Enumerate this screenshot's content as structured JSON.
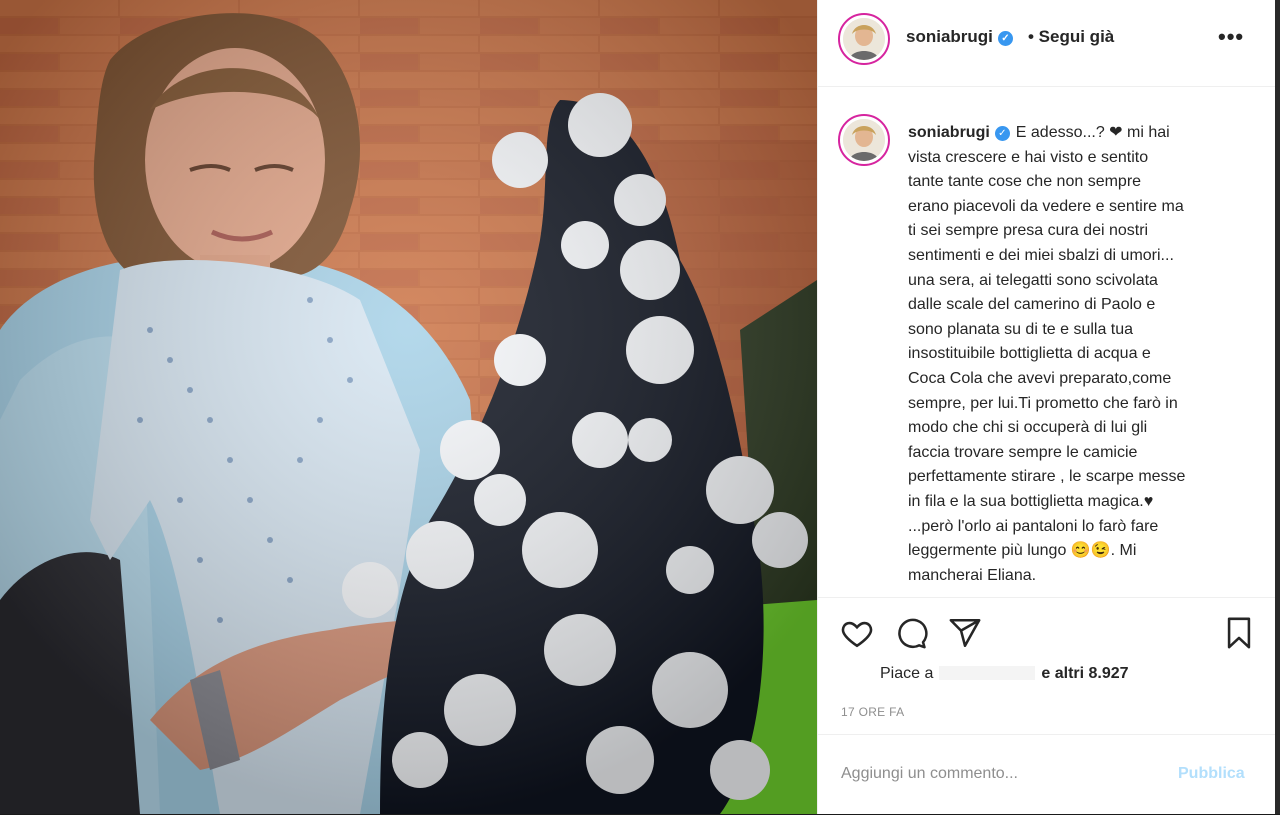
{
  "post": {
    "author": "soniabrugi",
    "follow_status": "• Segui già",
    "more_icon": "more-horizontal-icon",
    "caption_lines": [
      "E adesso...? ❤ mi hai",
      "vista crescere e hai visto e sentito",
      "tante tante cose che non sempre",
      "erano piacevoli da vedere e sentire ma",
      "ti sei sempre presa cura dei nostri",
      "sentimenti e dei miei sbalzi di umori...",
      "una sera, ai telegatti sono scivolata",
      "dalle scale del camerino di Paolo e",
      "sono planata su di te e sulla tua",
      "insostituibile bottiglietta di acqua e",
      "Coca Cola che avevi preparato,come",
      "sempre, per lui.Ti prometto che farò in",
      "modo che chi si occuperà di lui gli",
      "faccia trovare sempre le camicie",
      "perfettamente stirare , le scarpe messe",
      "in fila e la sua bottiglietta magica.♥",
      "...però l'orlo ai pantaloni lo farò fare",
      "leggermente più lungo 😊😉. Mi",
      "mancherai Eliana."
    ],
    "likes_prefix": "Piace a",
    "likes_suffix": "e altri",
    "likes_count": "8.927",
    "time_ago": "17 ORE FA",
    "comment_placeholder": "Aggiungi un commento...",
    "publish_label": "Pubblica"
  },
  "icons": {
    "like": "heart-icon",
    "comment": "comment-icon",
    "share": "send-icon",
    "save": "bookmark-icon"
  },
  "colors": {
    "verified": "#3897f0",
    "publish_disabled": "#b2dffc",
    "border": "#efefef",
    "muted": "#8e8e8e"
  }
}
